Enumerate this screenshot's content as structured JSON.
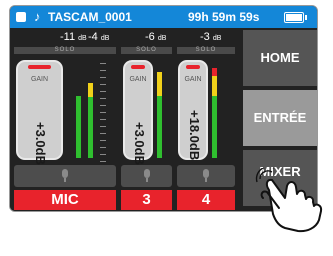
{
  "status_bar": {
    "filename": "TASCAM_0001",
    "remaining_time": "99h 59m 59s"
  },
  "channels": [
    {
      "peak": "-11",
      "peak2": "-4",
      "unit": "dB",
      "solo": "SOLO",
      "gain_label": "GAIN",
      "gain_value": "+3.0dB",
      "input_label": "MIC"
    },
    {
      "peak": "-6",
      "unit": "dB",
      "solo": "SOLO",
      "gain_label": "GAIN",
      "gain_value": "+3.0dB",
      "input_label": "3"
    },
    {
      "peak": "-3",
      "unit": "dB",
      "solo": "SOLO",
      "gain_label": "GAIN",
      "gain_value": "+18.0dB",
      "input_label": "4"
    }
  ],
  "nav": {
    "home": "HOME",
    "entree": "ENTRÉE",
    "mixer": "MIXER"
  },
  "colors": {
    "accent_blue": "#1487d8",
    "input_red": "#e8232c",
    "meter_green": "#2fbf2f",
    "meter_yellow": "#f1d11a"
  }
}
